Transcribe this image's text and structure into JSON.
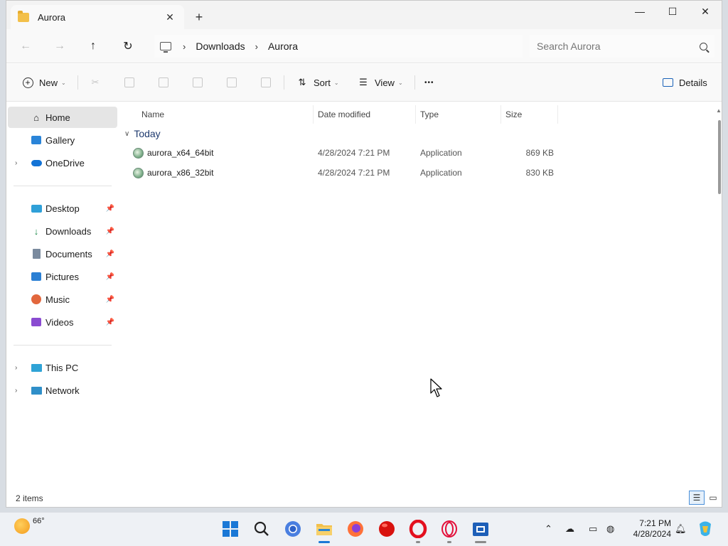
{
  "window": {
    "tab_title": "Aurora",
    "new_tab": "+",
    "close_tab": "✕",
    "controls": {
      "minimize": "—",
      "maximize": "☐",
      "close": "✕"
    }
  },
  "address": {
    "back": "←",
    "forward": "→",
    "up": "↑",
    "refresh": "↻",
    "breadcrumbs": [
      "Downloads",
      "Aurora"
    ],
    "search_placeholder": "Search Aurora"
  },
  "commands": {
    "new_label": "New",
    "sort_label": "Sort",
    "view_label": "View",
    "more": "•••",
    "details_label": "Details"
  },
  "navpane": {
    "quick": [
      {
        "label": "Home",
        "icon": "home-icon",
        "selected": true
      },
      {
        "label": "Gallery",
        "icon": "gallery-icon"
      },
      {
        "label": "OneDrive",
        "icon": "cloud-icon",
        "expandable": true
      }
    ],
    "pinned": [
      {
        "label": "Desktop",
        "icon": "desktop-icon"
      },
      {
        "label": "Downloads",
        "icon": "download-icon"
      },
      {
        "label": "Documents",
        "icon": "documents-icon"
      },
      {
        "label": "Pictures",
        "icon": "pictures-icon"
      },
      {
        "label": "Music",
        "icon": "music-icon"
      },
      {
        "label": "Videos",
        "icon": "videos-icon"
      }
    ],
    "locations": [
      {
        "label": "This PC",
        "icon": "pc-icon"
      },
      {
        "label": "Network",
        "icon": "network-icon"
      }
    ]
  },
  "filelist": {
    "columns": {
      "name": "Name",
      "date": "Date modified",
      "type": "Type",
      "size": "Size"
    },
    "group": "Today",
    "rows": [
      {
        "name": "aurora_x64_64bit",
        "date": "4/28/2024 7:21 PM",
        "type": "Application",
        "size": "869 KB"
      },
      {
        "name": "aurora_x86_32bit",
        "date": "4/28/2024 7:21 PM",
        "type": "Application",
        "size": "830 KB"
      }
    ]
  },
  "status": {
    "count": "2 items"
  },
  "taskbar": {
    "temperature": "66°",
    "time": "7:21 PM",
    "date": "4/28/2024",
    "colors": {
      "start": "#1a78d6",
      "firefox": "#ff7139",
      "opera": "#e3101e",
      "explorer": "#f3c04a"
    }
  }
}
